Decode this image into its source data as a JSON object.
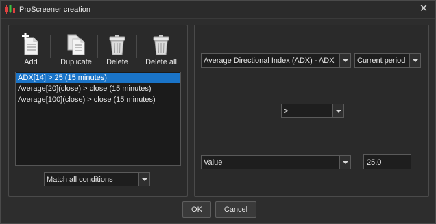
{
  "window": {
    "title": "ProScreener creation",
    "close_icon": "close-icon"
  },
  "toolbar": {
    "add_label": "Add",
    "duplicate_label": "Duplicate",
    "delete_label": "Delete",
    "delete_all_label": "Delete all"
  },
  "conditions": [
    "ADX[14] > 25 (15 minutes)",
    "Average[20](close) > close (15 minutes)",
    "Average[100](close) > close (15 minutes)"
  ],
  "match_mode": {
    "selected": "Match all conditions"
  },
  "editor": {
    "indicator": "Average Directional Index (ADX) - ADX",
    "period": "Current period",
    "operator": ">",
    "compare_type": "Value",
    "compare_value": "25.0"
  },
  "buttons": {
    "ok": "OK",
    "cancel": "Cancel"
  },
  "colors": {
    "selection": "#1a74c8",
    "background": "#2d2d2d"
  }
}
